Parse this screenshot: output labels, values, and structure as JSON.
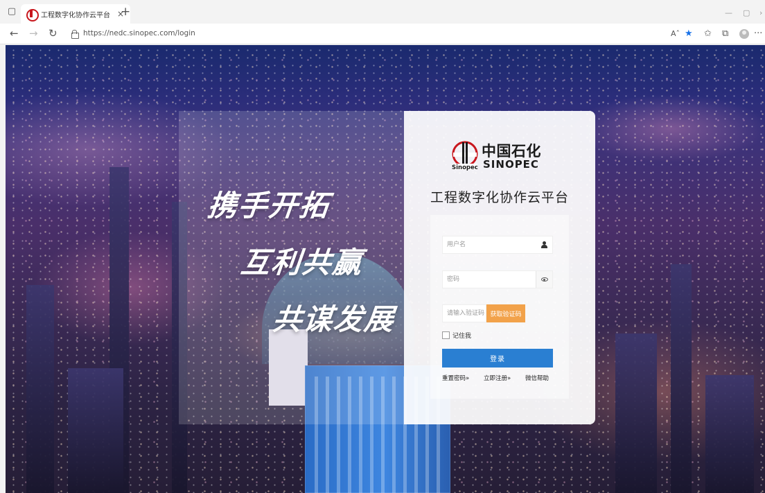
{
  "browser": {
    "tab": {
      "title": "工程数字化协作云平台",
      "close_glyph": "×"
    },
    "new_tab_glyph": "+",
    "window_controls": {
      "minimize": "—",
      "maximize": "▢",
      "chevron": "›"
    },
    "nav": {
      "back": "←",
      "forward": "→",
      "refresh": "↻"
    },
    "url": "https://nedc.sinopec.com/login",
    "toolbar": {
      "read_aloud": "Aˆ",
      "favorite": "★",
      "favorites_list": "✩",
      "collections": "⧉",
      "more": "···"
    },
    "colors": {
      "favorite_star": "#1a73e8"
    }
  },
  "slogans": [
    "携手开拓",
    "互利共赢",
    "共谋发展"
  ],
  "logo": {
    "cn": "中国石化",
    "en": "SINOPEC",
    "mark_text": "Sinopec"
  },
  "platform_title": "工程数字化协作云平台",
  "form": {
    "username": {
      "placeholder": "用户名",
      "value": ""
    },
    "password": {
      "placeholder": "密码",
      "value": ""
    },
    "captcha": {
      "placeholder": "请输入验证码",
      "value": "",
      "button": "获取验证码"
    },
    "remember_label": "记住我",
    "login_button": "登录",
    "links": {
      "reset": "重置密码»",
      "register": "立即注册»",
      "help": "微信帮助"
    }
  },
  "colors": {
    "login_button": "#2a7fd2",
    "captcha_button": "#f2a24a",
    "brand_red": "#c8161d"
  }
}
